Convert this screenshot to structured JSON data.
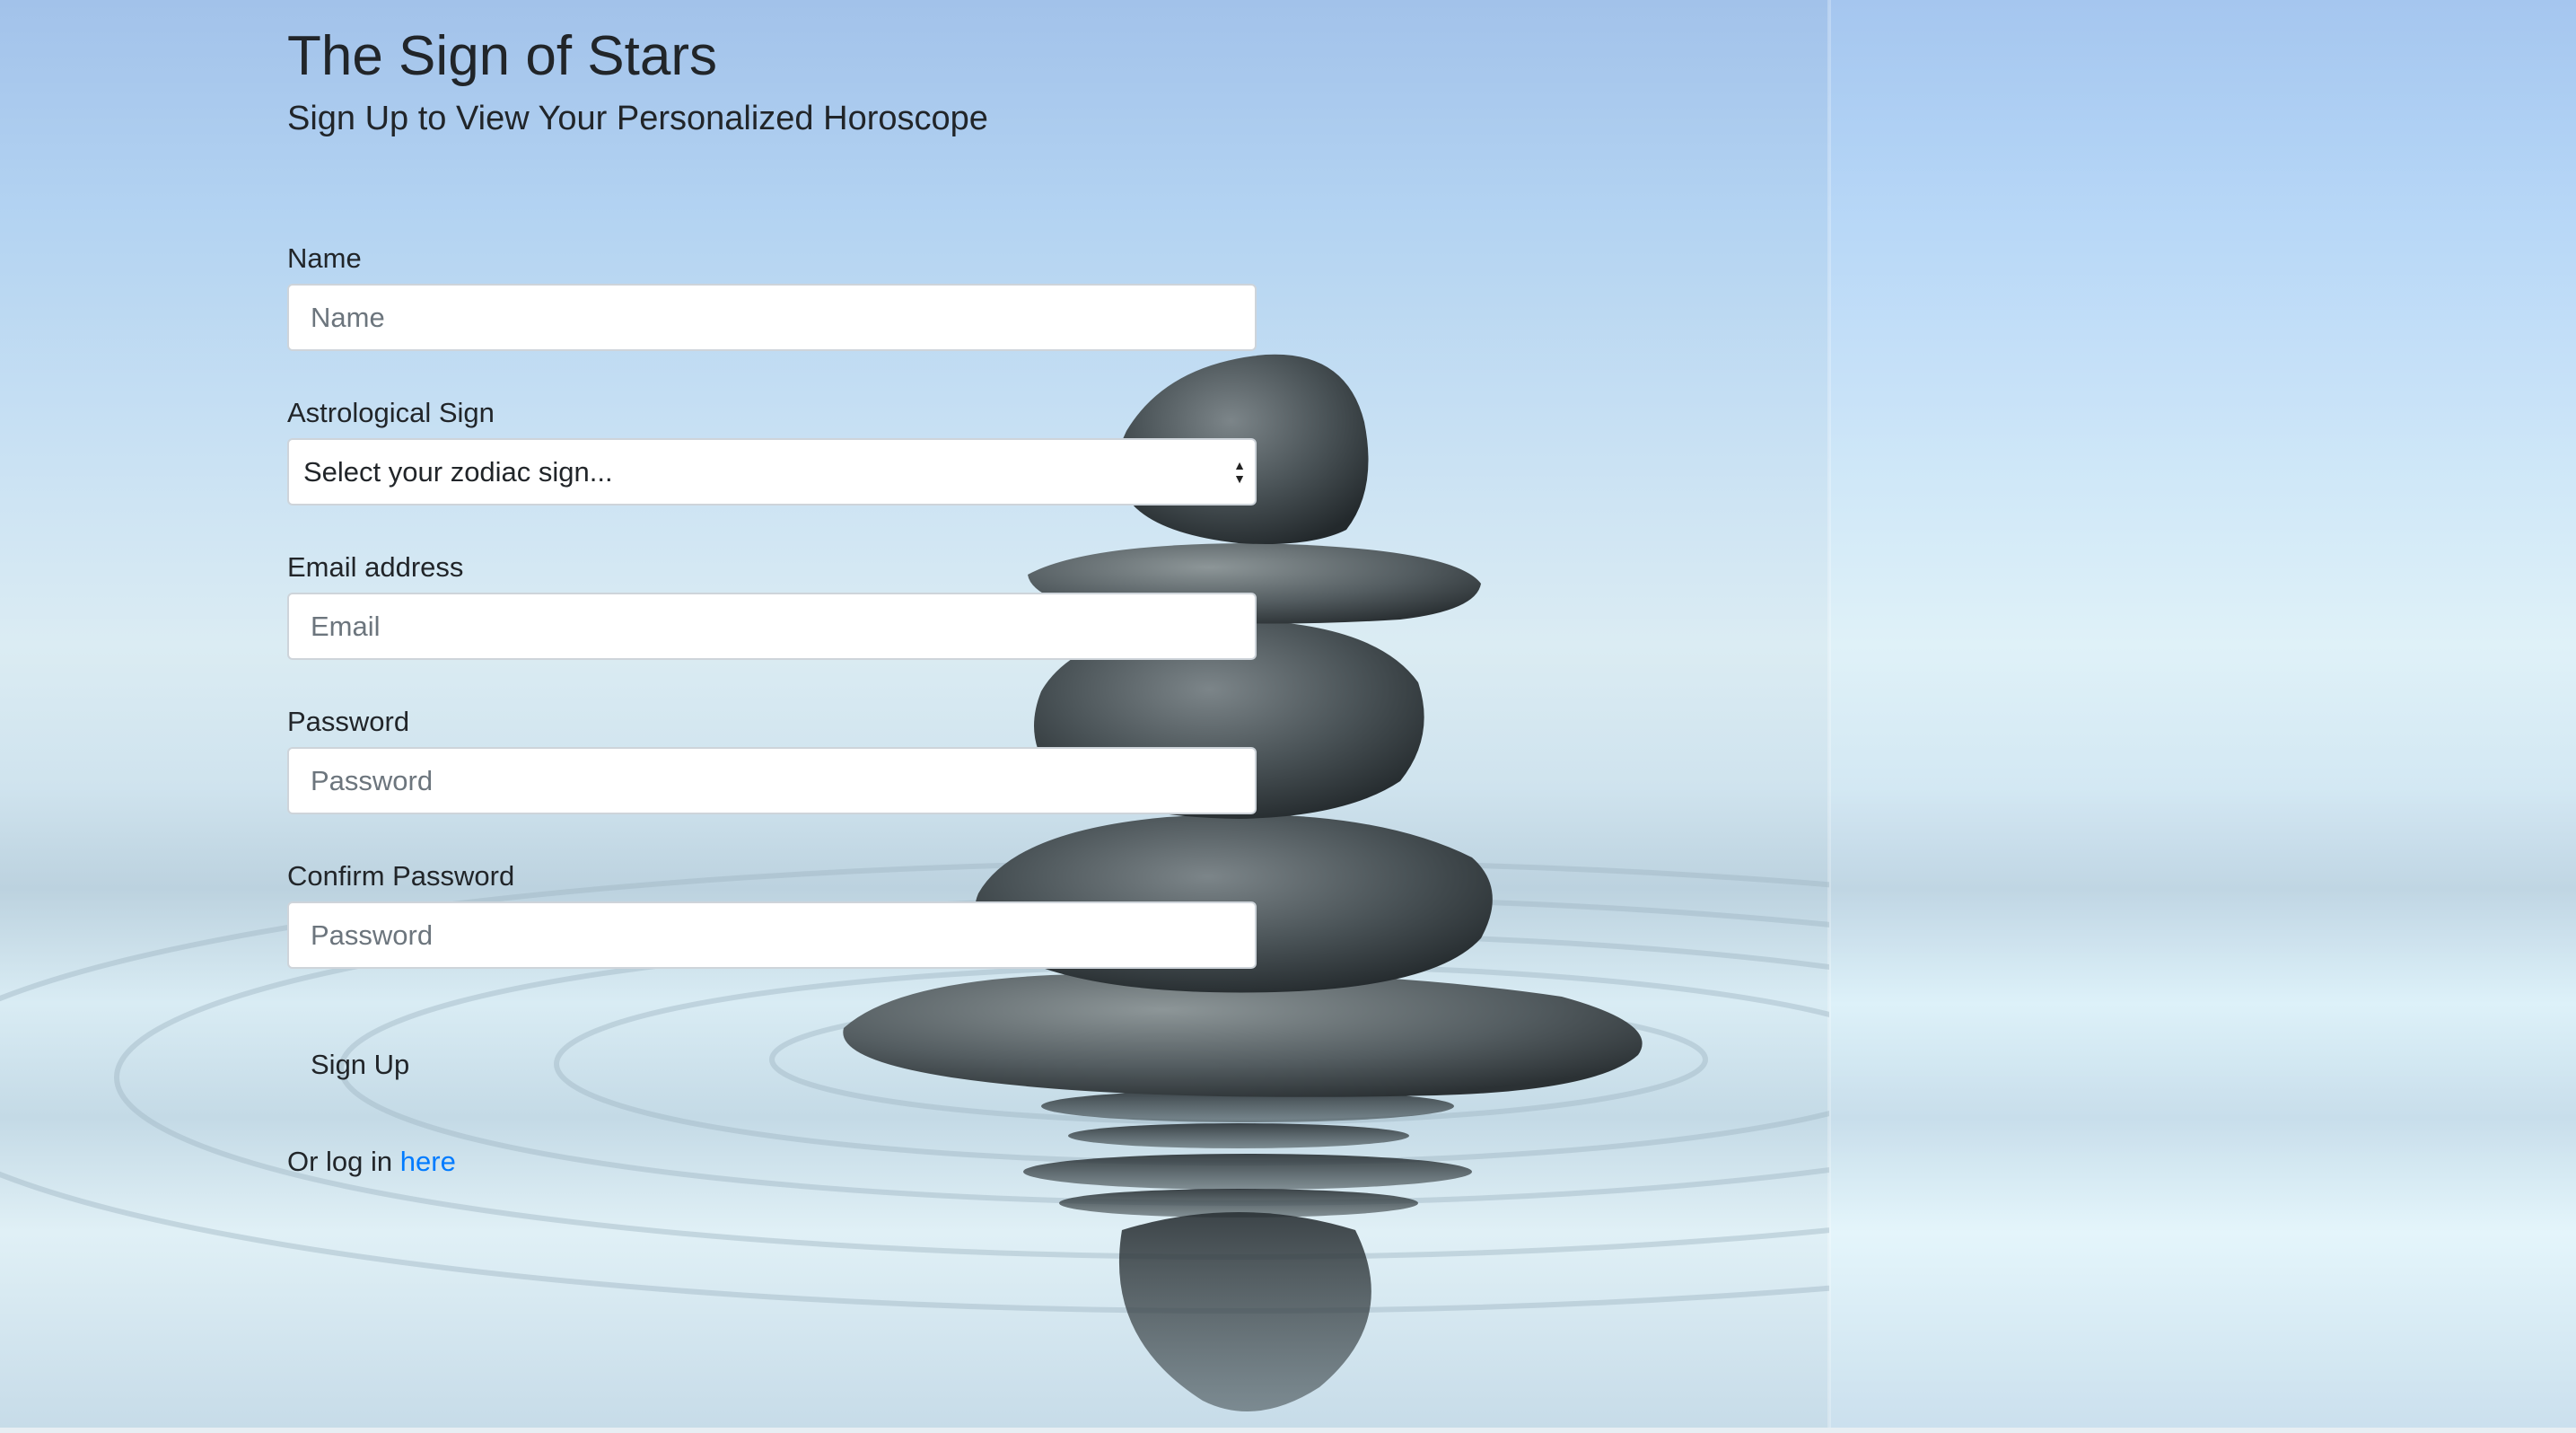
{
  "header": {
    "title": "The Sign of Stars",
    "subtitle": "Sign Up to View Your Personalized Horoscope"
  },
  "form": {
    "name": {
      "label": "Name",
      "placeholder": "Name",
      "value": ""
    },
    "sign": {
      "label": "Astrological Sign",
      "selected": "Select your zodiac sign..."
    },
    "email": {
      "label": "Email address",
      "placeholder": "Email",
      "value": ""
    },
    "password": {
      "label": "Password",
      "placeholder": "Password",
      "value": ""
    },
    "confirm_password": {
      "label": "Confirm Password",
      "placeholder": "Password",
      "value": ""
    },
    "submit_label": "Sign Up"
  },
  "login": {
    "prefix": "Or log in",
    "link_text": "here"
  },
  "colors": {
    "link": "#007bff",
    "text": "#212529",
    "input_border": "#ced4da"
  },
  "icons": {
    "select_arrows": "select-arrows-icon"
  }
}
